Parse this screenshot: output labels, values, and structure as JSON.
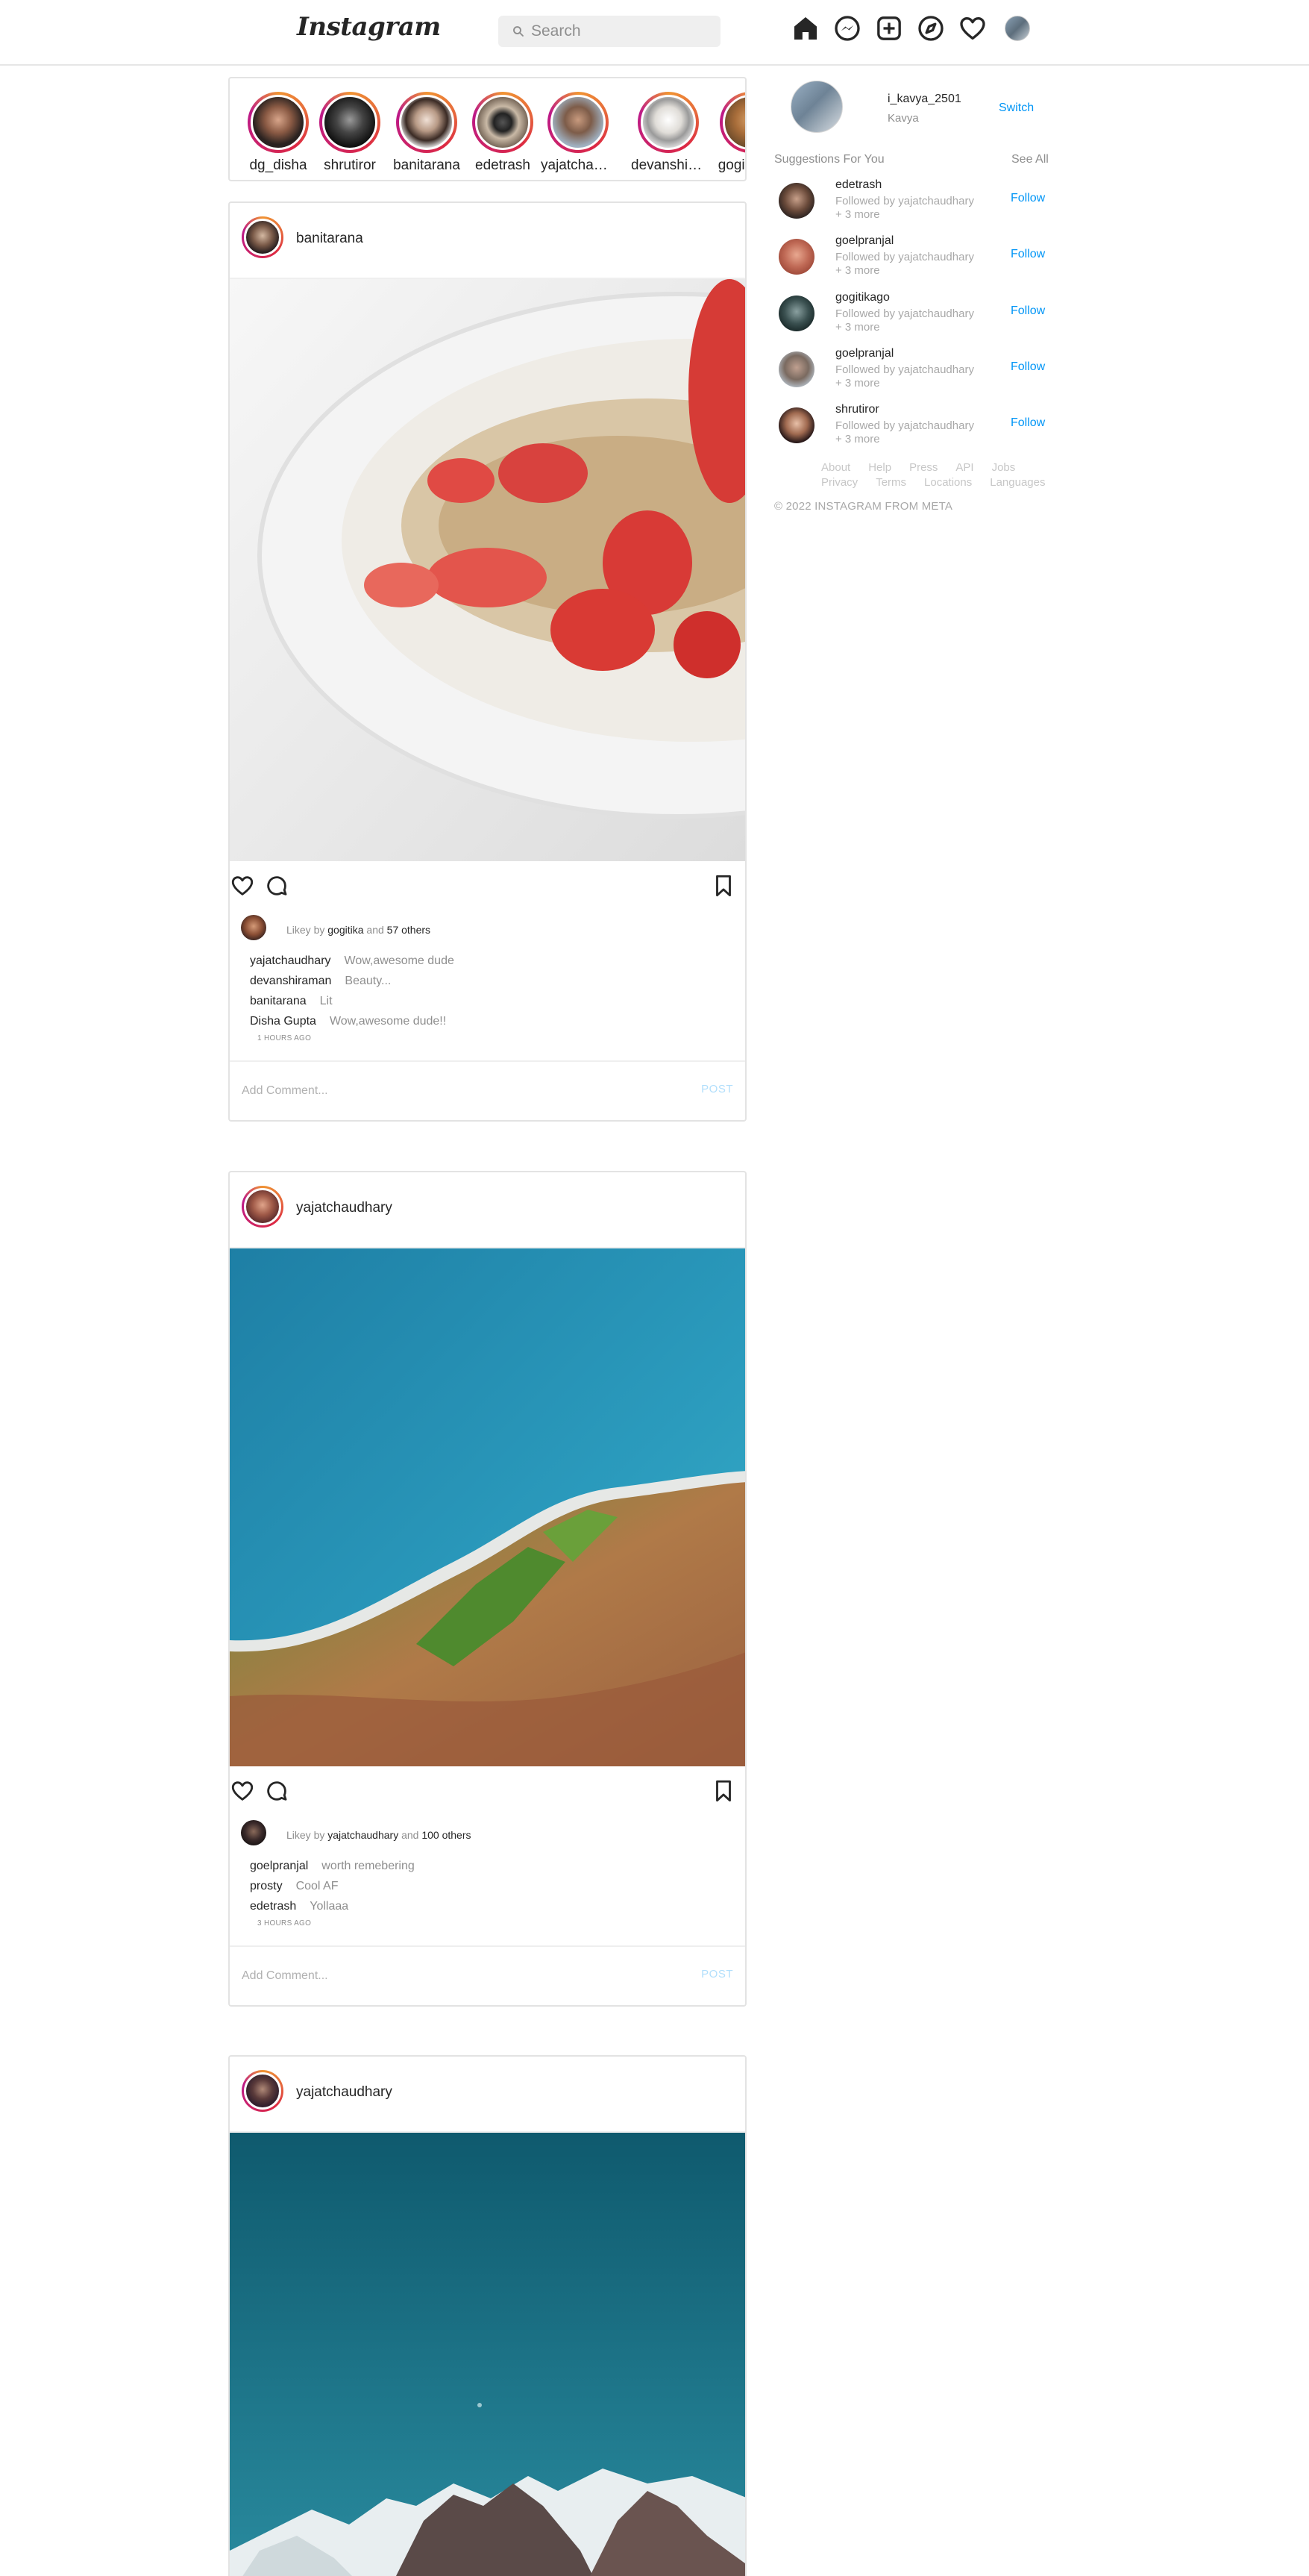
{
  "header": {
    "logo": "Instagram",
    "search_placeholder": "Search"
  },
  "stories": [
    {
      "name": "dg_disha"
    },
    {
      "name": "shrutiror"
    },
    {
      "name": "banitarana"
    },
    {
      "name": "edetrash"
    },
    {
      "name": "yajatchaudhary"
    },
    {
      "name": "devanshiraman"
    },
    {
      "name": "gogitikago"
    }
  ],
  "posts": [
    {
      "user": "banitarana",
      "liked_prefix": "Likey by",
      "liked_user": "gogitika",
      "liked_and": "and",
      "liked_others": "57 others",
      "comments": [
        {
          "user": "yajatchaudhary",
          "text": "Wow,awesome dude"
        },
        {
          "user": "devanshiraman",
          "text": "Beauty..."
        },
        {
          "user": "banitarana",
          "text": "Lit"
        },
        {
          "user": "Disha Gupta",
          "text": "Wow,awesome dude!!"
        }
      ],
      "time_ago": "1 HOURS AGO",
      "add_comment_placeholder": "Add Comment...",
      "post_label": "POST"
    },
    {
      "user": "yajatchaudhary",
      "liked_prefix": "Likey by",
      "liked_user": "yajatchaudhary",
      "liked_and": "and",
      "liked_others": "100 others",
      "comments": [
        {
          "user": "goelpranjal",
          "text": "worth remebering"
        },
        {
          "user": "prosty",
          "text": "Cool AF"
        },
        {
          "user": "edetrash",
          "text": "Yollaaa"
        }
      ],
      "time_ago": "3 HOURS AGO",
      "add_comment_placeholder": "Add Comment...",
      "post_label": "POST"
    },
    {
      "user": "yajatchaudhary"
    }
  ],
  "sidebar": {
    "username": "i_kavya_2501",
    "fullname": "Kavya",
    "switch_label": "Switch",
    "suggestions_title": "Suggestions For You",
    "see_all": "See All",
    "suggestions": [
      {
        "name": "edetrash",
        "followed_by": "Followed by yajatchaudhary",
        "more": "+ 3 more",
        "follow": "Follow"
      },
      {
        "name": "goelpranjal",
        "followed_by": "Followed by yajatchaudhary",
        "more": "+ 3 more",
        "follow": "Follow"
      },
      {
        "name": "gogitikago",
        "followed_by": "Followed by yajatchaudhary",
        "more": "+ 3 more",
        "follow": "Follow"
      },
      {
        "name": "goelpranjal",
        "followed_by": "Followed by yajatchaudhary",
        "more": "+ 3 more",
        "follow": "Follow"
      },
      {
        "name": "shrutiror",
        "followed_by": "Followed by yajatchaudhary",
        "more": "+ 3 more",
        "follow": "Follow"
      }
    ],
    "footer_links": [
      "About",
      "Help",
      "Press",
      "API",
      "Jobs",
      "Privacy",
      "Terms",
      "Locations",
      "Languages"
    ],
    "copyright": "© 2022 INSTAGRAM FROM META"
  },
  "colors": {
    "link_blue": "#0095f6",
    "post_disabled": "#b2dffc",
    "border": "#e3e3e3"
  }
}
